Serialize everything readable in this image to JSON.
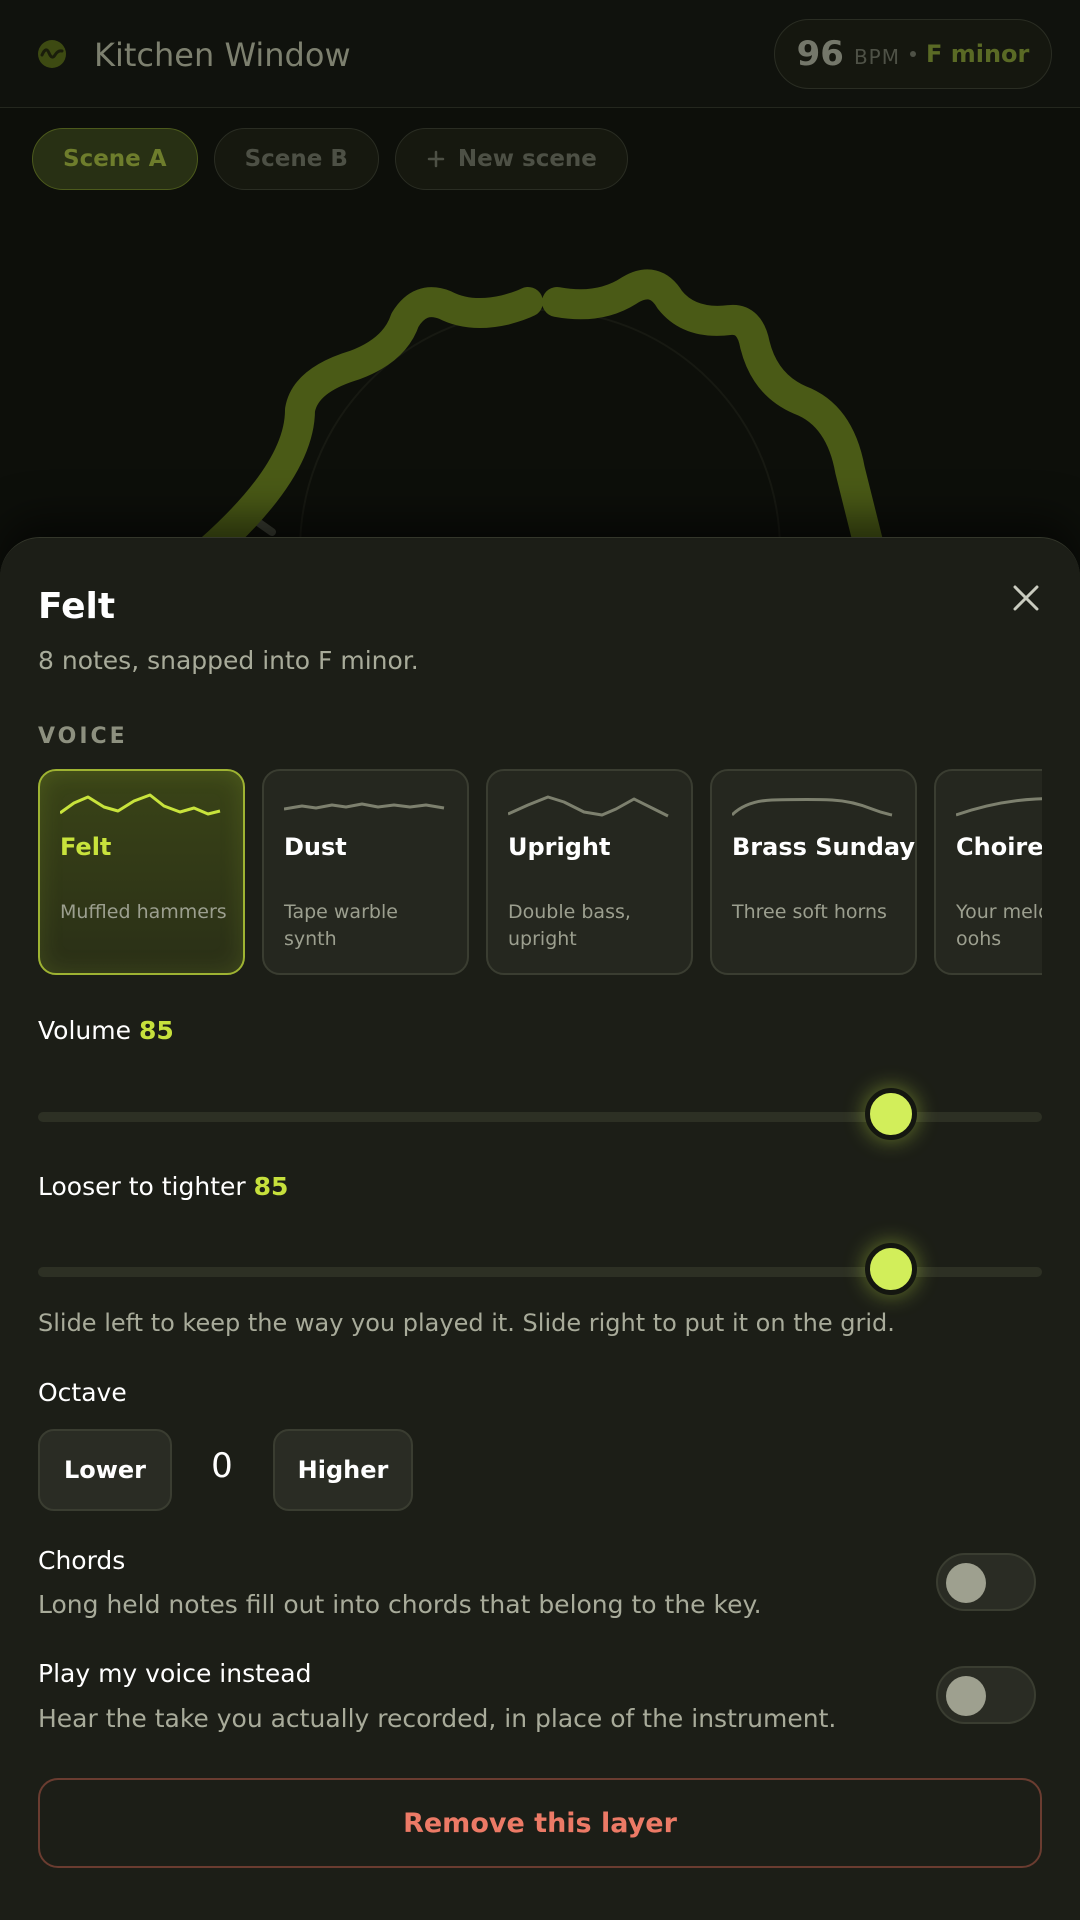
{
  "header": {
    "logo_icon": "waveform-logo-icon",
    "title": "Kitchen Window",
    "tempo": "96",
    "tempo_unit": "BPM",
    "key": "F minor"
  },
  "scenes": {
    "items": [
      {
        "label": "Scene A",
        "active": true
      },
      {
        "label": "Scene B",
        "active": false
      }
    ],
    "new_label": "New scene",
    "new_icon": "plus-icon"
  },
  "sheet": {
    "title": "Felt",
    "subtitle": "8 notes, snapped into F minor.",
    "close_icon": "close-icon",
    "voice_section_label": "VOICE",
    "voices": [
      {
        "name": "Felt",
        "description": "Muffled hammers",
        "selected": true
      },
      {
        "name": "Dust",
        "description": "Tape warble synth",
        "selected": false
      },
      {
        "name": "Upright",
        "description": "Double bass, upright",
        "selected": false
      },
      {
        "name": "Brass Sunday",
        "description": "Three soft horns",
        "selected": false
      },
      {
        "name": "Choirette",
        "description": "Your melody as oohs",
        "selected": false
      }
    ],
    "volume": {
      "label": "Volume",
      "value": 85
    },
    "tightness": {
      "label": "Looser to tighter",
      "value": 85
    },
    "tightness_hint": "Slide left to keep the way you played it. Slide right to put it on the grid.",
    "octave": {
      "label": "Octave",
      "lower_label": "Lower",
      "value": "0",
      "higher_label": "Higher"
    },
    "chords": {
      "title": "Chords",
      "description": "Long held notes fill out into chords that belong to the key.",
      "on": false
    },
    "voice_instead": {
      "title": "Play my voice instead",
      "description": "Hear the take you actually recorded, in place of the instrument.",
      "on": false
    },
    "remove_label": "Remove this layer"
  },
  "colors": {
    "accent": "#c6e03c",
    "danger": "#ec7a66",
    "sheet_bg": "#1c1e17"
  }
}
